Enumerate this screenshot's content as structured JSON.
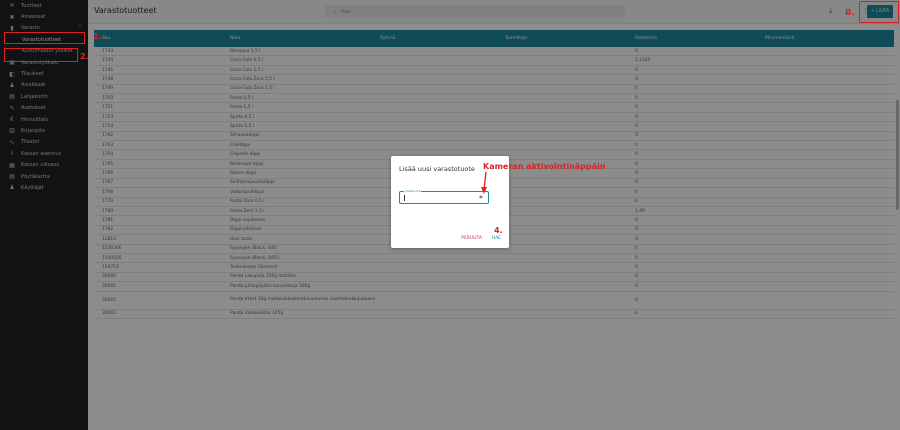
{
  "sidebar": {
    "items": [
      {
        "icon": "cutlery-icon",
        "glyph": "✕",
        "label": "Tuotteet"
      },
      {
        "icon": "tools-icon",
        "glyph": "✖",
        "label": "Ainesosat"
      },
      {
        "icon": "bar-chart-icon",
        "glyph": "▮",
        "label": "Varasto",
        "chevron": "^"
      },
      {
        "label": "Varastotuotteet",
        "sub": true
      },
      {
        "label": "Kustomoidut yksiköt",
        "sub": true
      },
      {
        "icon": "calendar-icon",
        "glyph": "▣",
        "label": "Varastotyökalu"
      },
      {
        "icon": "cart-icon",
        "glyph": "◧",
        "label": "Tilaukset"
      },
      {
        "icon": "people-icon",
        "glyph": "♟",
        "label": "Asiakkaat"
      },
      {
        "icon": "gift-icon",
        "glyph": "▤",
        "label": "Lahjakortit"
      },
      {
        "icon": "wrench-icon",
        "glyph": "✎",
        "label": "Asetukset"
      },
      {
        "icon": "euro-icon",
        "glyph": "€",
        "label": "Hinnoittelu"
      },
      {
        "icon": "book-icon",
        "glyph": "▥",
        "label": "Kirjanpito"
      },
      {
        "icon": "trend-icon",
        "glyph": "∿",
        "label": "Tilastot"
      },
      {
        "icon": "download-icon",
        "glyph": "⇩",
        "label": "Kassan asennus"
      },
      {
        "icon": "grid-icon",
        "glyph": "▦",
        "label": "Kassan ulkoasu"
      },
      {
        "icon": "table-icon",
        "glyph": "▤",
        "label": "Pöytäkartta"
      },
      {
        "icon": "users-icon",
        "glyph": "♟",
        "label": "Käyttäjät"
      }
    ]
  },
  "header": {
    "title": "Varastotuotteet",
    "search_placeholder": "Hae...",
    "search_icon": "search-icon",
    "add_label": "+ LISÄÄ",
    "icons": [
      "sort-icon",
      "download-icon",
      "more-vert-icon"
    ]
  },
  "table": {
    "columns": [
      "Sku",
      "Nimi",
      "Ryhmä",
      "Toimittaja",
      "Ostohinta",
      "Minimimäärä"
    ],
    "rows": [
      {
        "sku": "1743",
        "name": "Bonaqua 1,5 l",
        "count": "0"
      },
      {
        "sku": "1744",
        "name": "Coca-Cola 0,5 l",
        "count": "1,2345"
      },
      {
        "sku": "1745",
        "name": "Coca-Cola 1,5 l",
        "count": "0"
      },
      {
        "sku": "1748",
        "name": "Coca-Cola Zero 0,5 l",
        "count": "0"
      },
      {
        "sku": "1749",
        "name": "Coca-Cola Zero 1,5 l",
        "count": "0"
      },
      {
        "sku": "1750",
        "name": "Fanta 0,5 l",
        "count": "0"
      },
      {
        "sku": "1751",
        "name": "Fanta 1,5 l",
        "count": "0"
      },
      {
        "sku": "1753",
        "name": "Sprite 0,5 l",
        "count": "0"
      },
      {
        "sku": "1754",
        "name": "Sprite 1,5 l",
        "count": "0"
      },
      {
        "sku": "1762",
        "name": "Sitruunadippi",
        "count": "0"
      },
      {
        "sku": "1763",
        "name": "Chilidippi",
        "count": "0"
      },
      {
        "sku": "1764",
        "name": "Chipotle-dippi",
        "count": "0"
      },
      {
        "sku": "1765",
        "name": "Barbeque-dippi",
        "count": "0"
      },
      {
        "sku": "1766",
        "name": "Ranch-dippi",
        "count": "0"
      },
      {
        "sku": "1767",
        "name": "Sinihomejuustodippi",
        "count": "0"
      },
      {
        "sku": "1768",
        "name": "Valkosipulidippi",
        "count": "0"
      },
      {
        "sku": "1779",
        "name": "Fanta Zero 0,5 l",
        "count": "0"
      },
      {
        "sku": "1780",
        "name": "Fanta Zero 1,5 l",
        "count": "1,49"
      },
      {
        "sku": "1781",
        "name": "Dippi-sopikeeeli",
        "count": "0"
      },
      {
        "sku": "1782",
        "name": "Dippi-pikdevei",
        "count": "0"
      },
      {
        "sku": "12813",
        "name": "Uusi tuote",
        "count": "0"
      },
      {
        "sku": "1530306",
        "name": "Syyssyke (Black, 4/8)",
        "count": "0"
      },
      {
        "sku": "1540505",
        "name": "Syyssyke (Black, 4/05)",
        "count": "0"
      },
      {
        "sku": "159753",
        "name": "Testivarasto (Sininen)",
        "count": "0"
      },
      {
        "sku": "30000",
        "name": "Panda Lakupala 250g laatikko",
        "count": "0"
      },
      {
        "sku": "30001",
        "name": "Panda Juhlapöydän konvehteja 300g",
        "count": "0"
      },
      {
        "sku": "30002",
        "name": "Panda Irtket 20g maitosuklaakarkkiuomuista vaahtokarkkipalaasa",
        "count": "0",
        "tall": true
      },
      {
        "sku": "30003",
        "name": "Panda Valkosuklaa 145g",
        "count": "0"
      }
    ]
  },
  "dialog": {
    "title": "Lisää uusi varastotuote",
    "field_label": "Viivakoodi",
    "field_value": "",
    "scan_icon": "barcode-scan-icon",
    "cancel_label": "PERUUTA",
    "add_label": "HAE"
  },
  "annotations": {
    "n1": "1.",
    "n2": "2.",
    "n3": "3.",
    "n4": "4.",
    "camera": "Kameran aktivointinäppäin",
    "color": "#e02020"
  }
}
